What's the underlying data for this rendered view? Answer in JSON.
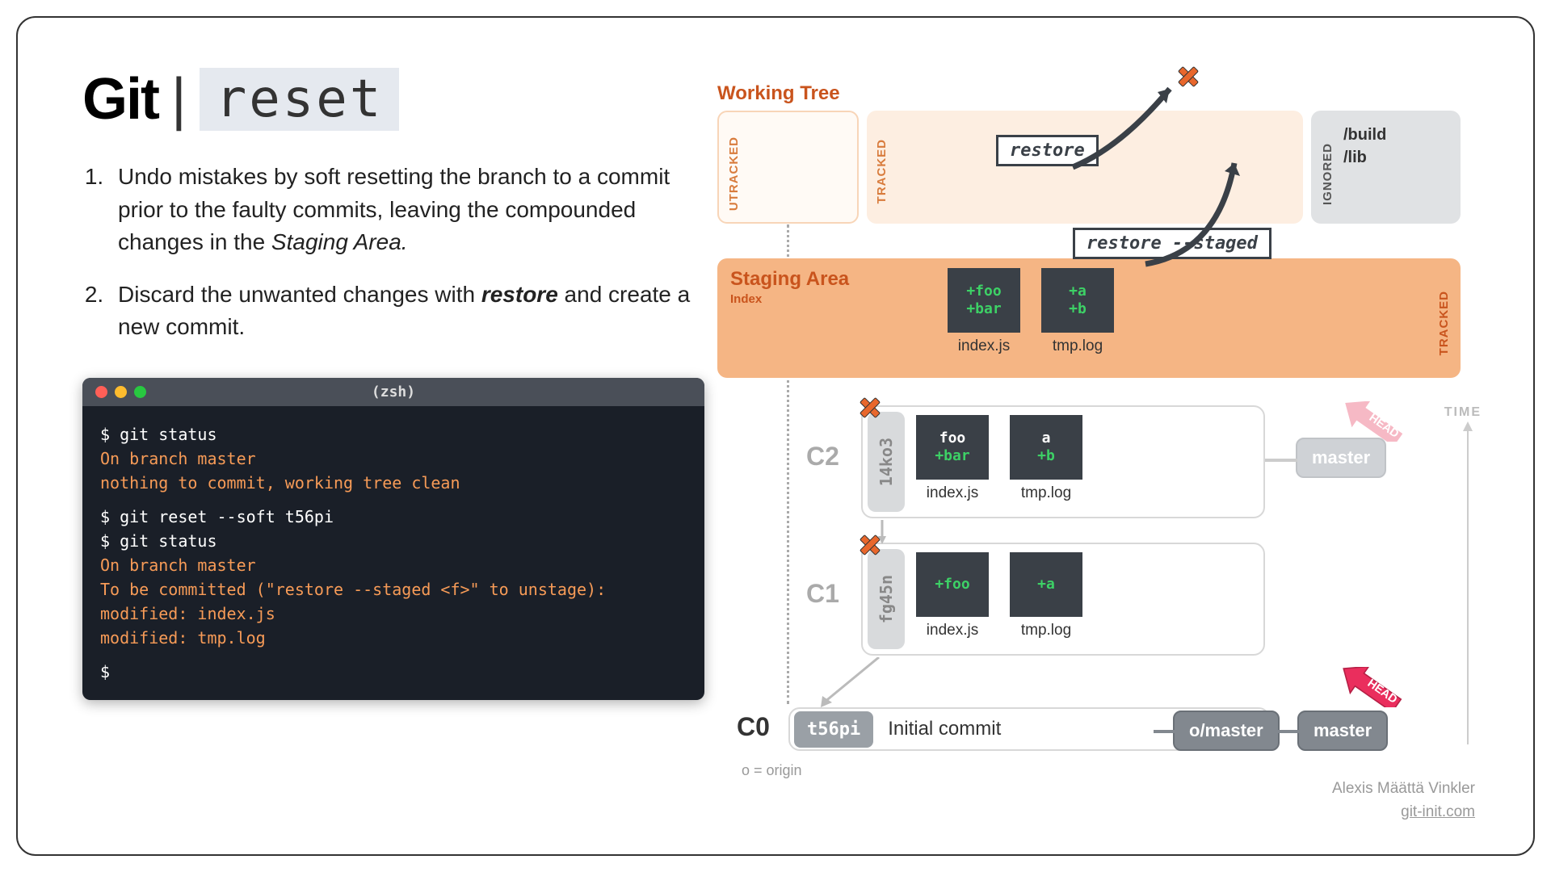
{
  "title": {
    "git": "Git",
    "pipe": "|",
    "cmd": "reset"
  },
  "steps": [
    "Undo mistakes by soft resetting the branch to a commit prior to the faulty commits, leaving the compounded changes in the <em>Staging Area.</em>",
    "Discard the unwanted changes with <strong>restore</strong> and create a new commit."
  ],
  "terminal": {
    "title": "(zsh)",
    "lines": [
      {
        "t": "$ git status",
        "c": "w"
      },
      {
        "t": "On branch master",
        "c": "o"
      },
      {
        "t": "nothing to commit, working tree clean",
        "c": "o",
        "gap": true
      },
      {
        "t": "$ git reset --soft t56pi",
        "c": "w"
      },
      {
        "t": "$ git status",
        "c": "w"
      },
      {
        "t": "On branch master",
        "c": "o"
      },
      {
        "t": "To be committed (\"restore --staged <f>\" to unstage):",
        "c": "o"
      },
      {
        "t": "    modified: index.js",
        "c": "o"
      },
      {
        "t": "    modified: tmp.log",
        "c": "o",
        "gap": true
      },
      {
        "t": "$",
        "c": "w"
      }
    ]
  },
  "workingTree": {
    "label": "Working Tree",
    "utracked": "UTRACKED",
    "tracked": "TRACKED",
    "ignored": "IGNORED",
    "ignoredFiles": [
      "/build",
      "/lib"
    ]
  },
  "stagingArea": {
    "label": "Staging Area",
    "sub": "Index",
    "tracked": "TRACKED"
  },
  "staged": [
    {
      "name": "index.js",
      "lines": [
        {
          "t": "+foo",
          "c": "g"
        },
        {
          "t": "+bar",
          "c": "g"
        }
      ]
    },
    {
      "name": "tmp.log",
      "lines": [
        {
          "t": "+a",
          "c": "g"
        },
        {
          "t": "+b",
          "c": "g"
        }
      ]
    }
  ],
  "commits": {
    "c2": {
      "label": "C2",
      "hash": "14ko3",
      "files": [
        {
          "name": "index.js",
          "lines": [
            {
              "t": "foo",
              "c": "w"
            },
            {
              "t": "+bar",
              "c": "g"
            }
          ]
        },
        {
          "name": "tmp.log",
          "lines": [
            {
              "t": "a",
              "c": "w"
            },
            {
              "t": "+b",
              "c": "g"
            }
          ]
        }
      ]
    },
    "c1": {
      "label": "C1",
      "hash": "fg45n",
      "files": [
        {
          "name": "index.js",
          "lines": [
            {
              "t": "+foo",
              "c": "g"
            }
          ]
        },
        {
          "name": "tmp.log",
          "lines": [
            {
              "t": "+a",
              "c": "g"
            }
          ]
        }
      ]
    },
    "c0": {
      "label": "C0",
      "hash": "t56pi",
      "msg": "Initial commit"
    }
  },
  "branches": {
    "omaster": "o/master",
    "master": "master",
    "master_faded": "master"
  },
  "commands": {
    "restore": "restore",
    "restoreStaged": "restore --staged"
  },
  "head": "HEAD",
  "time": "TIME",
  "originNote": "o = origin",
  "credit": {
    "author": "Alexis Määttä Vinkler",
    "site": "git-init.com"
  }
}
